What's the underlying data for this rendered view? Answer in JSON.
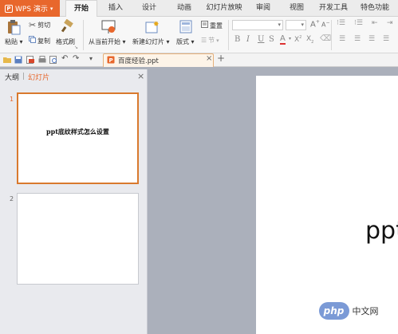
{
  "menubar": {
    "app_label": "WPS 演示",
    "tabs": [
      "开始",
      "插入",
      "设计",
      "动画",
      "幻灯片放映",
      "审阅",
      "视图",
      "开发工具",
      "特色功能"
    ],
    "active_tab": "开始"
  },
  "ribbon": {
    "paste_label": "粘贴",
    "cut_label": "剪切",
    "copy_label": "复制",
    "format_painter_label": "格式刷",
    "from_current_label": "从当前开始",
    "new_slide_label": "新建幻灯片",
    "layout_label": "版式",
    "reset_label": "重置",
    "section_label": "节",
    "font_size_up": "A",
    "font_size_down": "A",
    "bold": "B",
    "italic": "I",
    "underline": "U",
    "shadow": "S",
    "font_color": "A",
    "superscript": "X",
    "subscript": "X"
  },
  "quick_access": {
    "doc_tab_title": "百度经验.ppt",
    "close_glyph": "×",
    "new_tab_glyph": "+"
  },
  "left_panel": {
    "tab_outline": "大纲",
    "tab_slides": "幻灯片",
    "close_glyph": "×",
    "slides": [
      {
        "number": "1",
        "text": "ppt底纹样式怎么设置"
      },
      {
        "number": "2",
        "text": ""
      }
    ]
  },
  "canvas": {
    "visible_text": "ppt"
  },
  "watermark": {
    "logo_text": "php",
    "site_text": "中文网"
  },
  "colors": {
    "accent": "#e8672c",
    "slide_selected_border": "#d9792e",
    "menubar_bg": "#ececec",
    "workspace_bg": "#abb0bb"
  }
}
